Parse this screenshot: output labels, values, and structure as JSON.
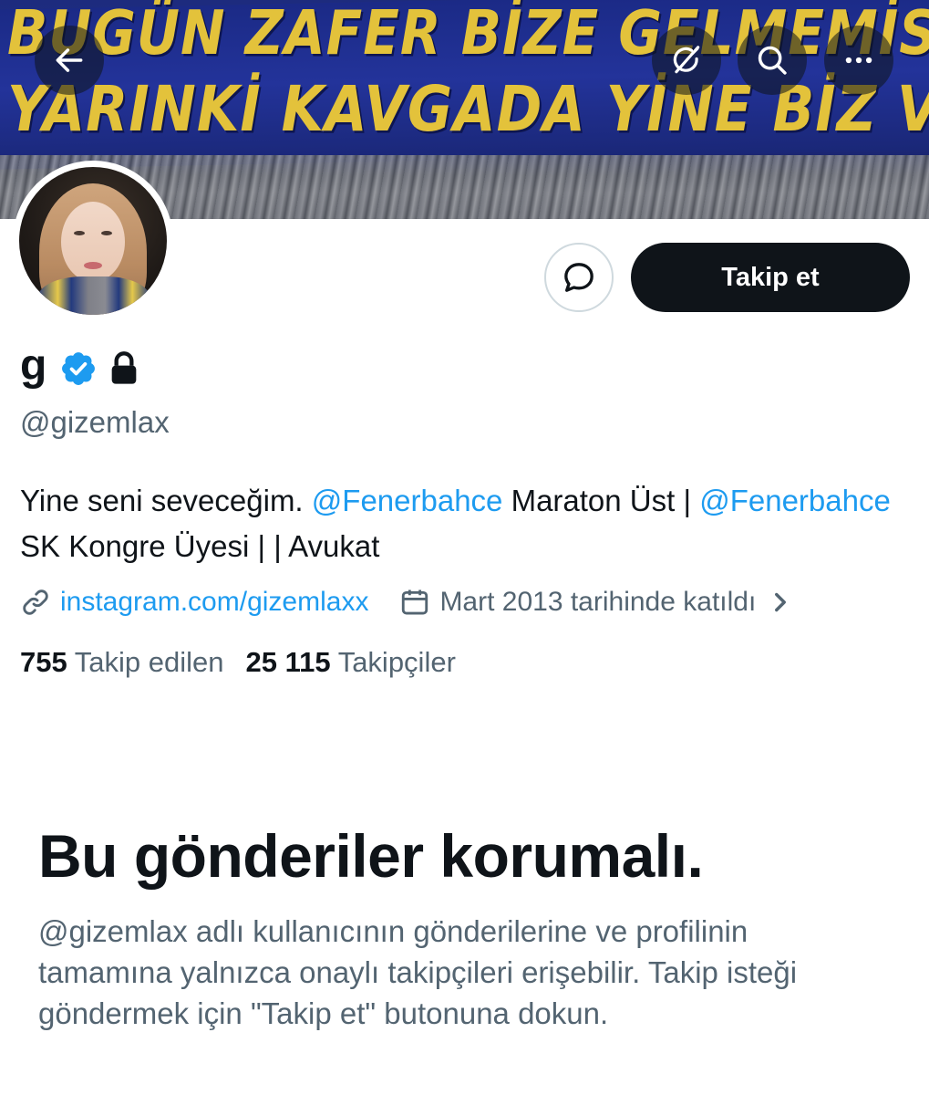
{
  "banner": {
    "line1": "BUGÜN ZAFER BİZE GELMEMİSSE DE",
    "line2": "YARINKİ KAVGADA YİNE BİZ VARIZ"
  },
  "header_icons": {
    "back": "arrow-left-icon",
    "grok": "grok-icon",
    "search": "search-icon",
    "more": "more-horizontal-icon"
  },
  "actions": {
    "message_icon": "message-icon",
    "follow_label": "Takip et"
  },
  "profile": {
    "display_name": "g",
    "handle": "@gizemlax",
    "bio": {
      "part1": "Yine seni seveceğim. ",
      "mention1": "@Fenerbahce",
      "part2": " Maraton Üst | ",
      "mention2": "@Fenerbahce",
      "part3": " SK Kongre Üyesi | | Avukat"
    },
    "link": "instagram.com/gizemlaxx",
    "joined": "Mart 2013 tarihinde katıldı",
    "following_count": "755",
    "following_label": "Takip edilen",
    "followers_count": "25 115",
    "followers_label": "Takipçiler"
  },
  "protected": {
    "title": "Bu gönderiler korumalı.",
    "description": "@gizemlax adlı kullanıcının gönderilerine ve profilinin tamamına yalnızca onaylı takipçileri erişebilir. Takip isteği göndermek için \"Takip et\" butonuna dokun."
  },
  "colors": {
    "accent": "#1d9bf0",
    "text": "#0f1419",
    "secondary": "#536471",
    "banner_blue": "#23339a",
    "banner_yellow": "#e3c23b"
  }
}
